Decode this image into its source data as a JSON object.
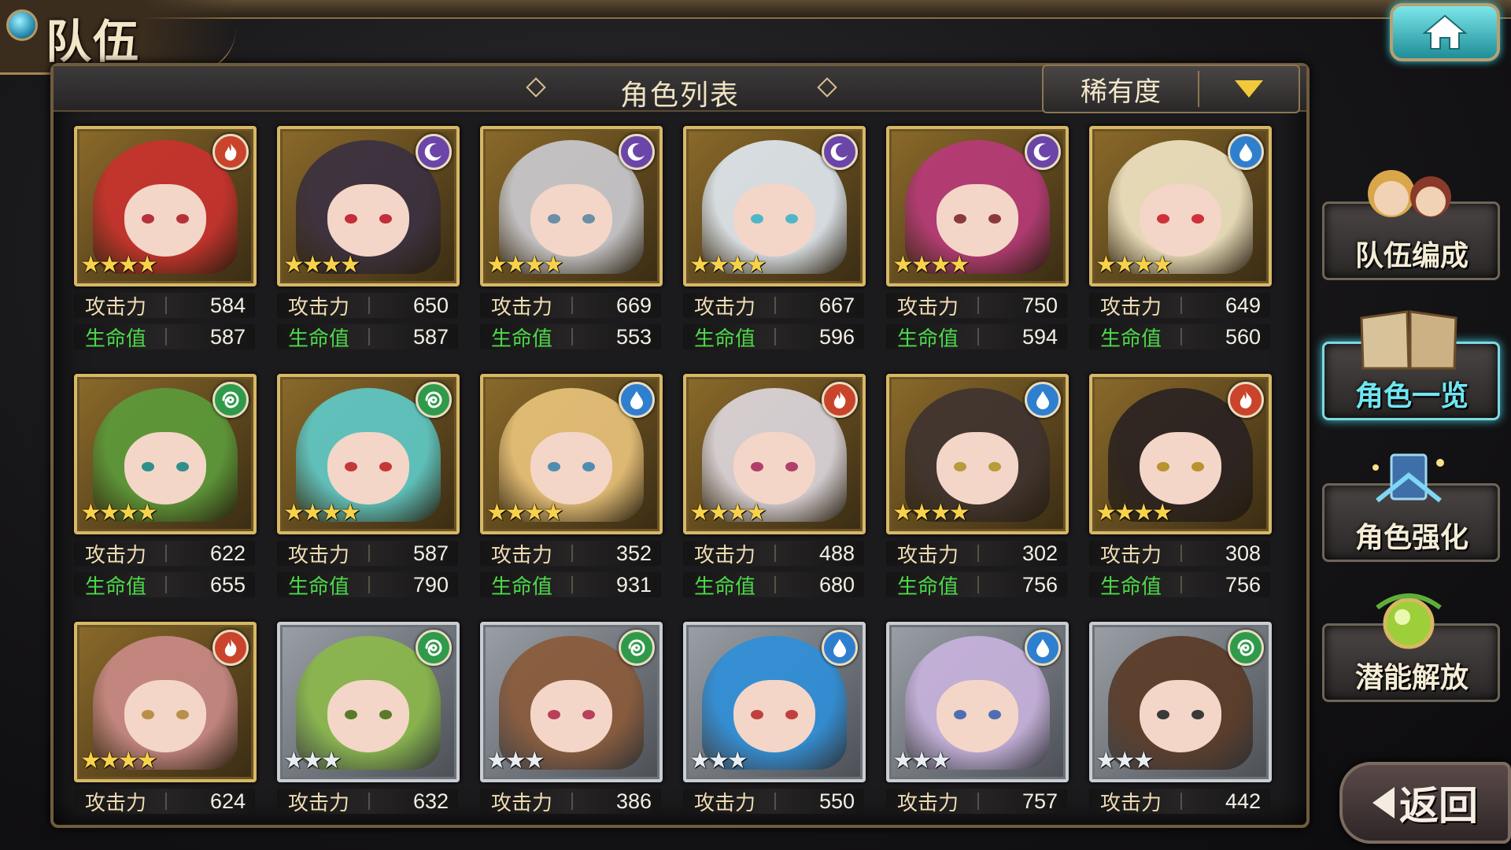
{
  "header": {
    "title": "队伍"
  },
  "list": {
    "title": "角色列表",
    "sort_label": "稀有度"
  },
  "stat_labels": {
    "attack": "攻击力",
    "hp": "生命值"
  },
  "elements": {
    "fire": "#c9442a",
    "moon": "#6b45a8",
    "water": "#2f7fcf",
    "wind": "#2f9a4a"
  },
  "characters": [
    {
      "element": "fire",
      "stars": 4,
      "frame": "gold",
      "attack": "584",
      "hp": "587",
      "hair": "#c8322e",
      "eye": "#b6323a"
    },
    {
      "element": "moon",
      "stars": 4,
      "frame": "gold",
      "attack": "650",
      "hp": "587",
      "hair": "#3a3040",
      "eye": "#c42d3a"
    },
    {
      "element": "moon",
      "stars": 4,
      "frame": "gold",
      "attack": "669",
      "hp": "553",
      "hair": "#c9c9ce",
      "eye": "#6a8fa6"
    },
    {
      "element": "moon",
      "stars": 4,
      "frame": "gold",
      "attack": "667",
      "hp": "596",
      "hair": "#dfe7ef",
      "eye": "#4fb6c8"
    },
    {
      "element": "moon",
      "stars": 4,
      "frame": "gold",
      "attack": "750",
      "hp": "594",
      "hair": "#b73a78",
      "eye": "#8b3a3a"
    },
    {
      "element": "water",
      "stars": 4,
      "frame": "gold",
      "attack": "649",
      "hp": "560",
      "hair": "#efe3c2",
      "eye": "#d0303a"
    },
    {
      "element": "wind",
      "stars": 4,
      "frame": "gold",
      "attack": "622",
      "hp": "655",
      "hair": "#5c9a3a",
      "eye": "#2f8f8a"
    },
    {
      "element": "wind",
      "stars": 4,
      "frame": "gold",
      "attack": "587",
      "hp": "790",
      "hair": "#5fc9c6",
      "eye": "#c4383a"
    },
    {
      "element": "water",
      "stars": 4,
      "frame": "gold",
      "attack": "352",
      "hp": "931",
      "hair": "#e8c27a",
      "eye": "#4f8db0"
    },
    {
      "element": "fire",
      "stars": 4,
      "frame": "gold",
      "attack": "488",
      "hp": "680",
      "hair": "#dcd6dc",
      "eye": "#b0406a"
    },
    {
      "element": "water",
      "stars": 4,
      "frame": "gold",
      "attack": "302",
      "hp": "756",
      "hair": "#3f3330",
      "eye": "#b89b3a"
    },
    {
      "element": "fire",
      "stars": 4,
      "frame": "gold",
      "attack": "308",
      "hp": "756",
      "hair": "#2a2222",
      "eye": "#b8932e"
    },
    {
      "element": "fire",
      "stars": 4,
      "frame": "gold",
      "attack": "624",
      "hp": "",
      "hair": "#c98a86",
      "eye": "#b8904a"
    },
    {
      "element": "wind",
      "stars": 3,
      "frame": "silver",
      "attack": "632",
      "hp": "",
      "hair": "#8ab84a",
      "eye": "#5a7a2a"
    },
    {
      "element": "wind",
      "stars": 3,
      "frame": "silver",
      "attack": "386",
      "hp": "",
      "hair": "#8a5a3a",
      "eye": "#b8405a"
    },
    {
      "element": "water",
      "stars": 3,
      "frame": "silver",
      "attack": "550",
      "hp": "",
      "hair": "#2f8fd8",
      "eye": "#c04040"
    },
    {
      "element": "water",
      "stars": 3,
      "frame": "silver",
      "attack": "757",
      "hp": "",
      "hair": "#c7b2dc",
      "eye": "#4f6fb0"
    },
    {
      "element": "wind",
      "stars": 3,
      "frame": "silver",
      "attack": "442",
      "hp": "",
      "hair": "#5a3a26",
      "eye": "#3a3a3a"
    }
  ],
  "side_menu": [
    {
      "label": "队伍编成",
      "icon": "party-icon",
      "active": false
    },
    {
      "label": "角色一览",
      "icon": "book-icon",
      "active": true
    },
    {
      "label": "角色强化",
      "icon": "enhance-icon",
      "active": false
    },
    {
      "label": "潜能解放",
      "icon": "potential-orb-icon",
      "active": false
    }
  ],
  "back_label": "返回"
}
